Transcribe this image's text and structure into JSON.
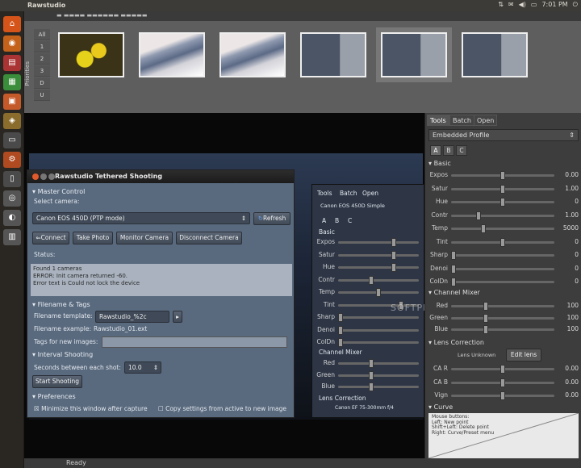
{
  "topbar": {
    "title": "Rawstudio",
    "time": "7:01 PM"
  },
  "thumbnails": {
    "priorities_label": "Priorities",
    "priorities": [
      "All",
      "1",
      "2",
      "3",
      "D",
      "U"
    ]
  },
  "tethered": {
    "title": "Rawstudio Tethered Shooting",
    "master_control": "Master Control",
    "select_camera": "Select camera:",
    "camera": "Canon EOS 450D (PTP mode)",
    "refresh": "Refresh",
    "connect": "Connect",
    "take_photo": "Take Photo",
    "monitor_camera": "Monitor Camera",
    "disconnect_camera": "Disconnect Camera",
    "status_label": "Status:",
    "status_lines": [
      "Found 1 cameras",
      "ERROR: Init camera returned -60.",
      "Error text is Could not lock the device"
    ],
    "filename_tags": "Filename & Tags",
    "filename_template_label": "Filename template:",
    "filename_template": "Rawstudio_%2c",
    "filename_example_label": "Filename example:",
    "filename_example": "Rawstudio_01.ext",
    "tags_label": "Tags for new images:",
    "interval_shooting": "Interval Shooting",
    "seconds_label": "Seconds between each shot:",
    "seconds_value": "10.0",
    "start_shooting": "Start Shooting",
    "preferences": "Preferences",
    "minimize": "Minimize this window after capture",
    "copy_settings": "Copy settings from active to new image"
  },
  "inner": {
    "tabs": [
      "Tools",
      "Batch",
      "Open"
    ],
    "profile": "Canon EOS 450D Simple",
    "abc": [
      "A",
      "B",
      "C"
    ],
    "basic": "Basic",
    "sliders": [
      "Expos",
      "Satur",
      "Hue",
      "Contr",
      "Temp",
      "Tint",
      "Sharp",
      "Denoi",
      "ColDn"
    ],
    "channel_mixer": "Channel Mixer",
    "channels": [
      "Red",
      "Green",
      "Blue"
    ],
    "lens_correction": "Lens Correction",
    "lens_text": "Canon EF 75-300mm f/4"
  },
  "tools": {
    "tabs": [
      "Tools",
      "Batch",
      "Open"
    ],
    "profile": "Embedded Profile",
    "abc": [
      "A",
      "B",
      "C"
    ],
    "basic": "Basic",
    "basic_sliders": [
      {
        "label": "Expos",
        "value": "0.00",
        "pos": 0.5
      },
      {
        "label": "Satur",
        "value": "1.00",
        "pos": 0.5
      },
      {
        "label": "Hue",
        "value": "0",
        "pos": 0.5
      },
      {
        "label": "Contr",
        "value": "1.00",
        "pos": 0.25
      },
      {
        "label": "Temp",
        "value": "5000",
        "pos": 0.3
      },
      {
        "label": "Tint",
        "value": "0",
        "pos": 0.5
      },
      {
        "label": "Sharp",
        "value": "0",
        "pos": 0.0
      },
      {
        "label": "Denoi",
        "value": "0",
        "pos": 0.0
      },
      {
        "label": "ColDn",
        "value": "0",
        "pos": 0.0
      }
    ],
    "channel_mixer": "Channel Mixer",
    "channel_sliders": [
      {
        "label": "Red",
        "value": "100",
        "pos": 0.33
      },
      {
        "label": "Green",
        "value": "100",
        "pos": 0.33
      },
      {
        "label": "Blue",
        "value": "100",
        "pos": 0.33
      }
    ],
    "lens_correction": "Lens Correction",
    "lens_unknown": "Lens Unknown",
    "edit_lens": "Edit lens",
    "lens_sliders": [
      {
        "label": "CA R",
        "value": "0.00",
        "pos": 0.5
      },
      {
        "label": "CA B",
        "value": "0.00",
        "pos": 0.5
      },
      {
        "label": "Vign",
        "value": "0.00",
        "pos": 0.5
      }
    ],
    "curve": "Curve",
    "curve_help": [
      "Mouse buttons:",
      "Left: New point",
      "Shift+Left: Delete point",
      "Right: Curve/Preset menu"
    ]
  },
  "statusbar": {
    "text": "Ready"
  },
  "watermark": "SOFTPEDIA"
}
